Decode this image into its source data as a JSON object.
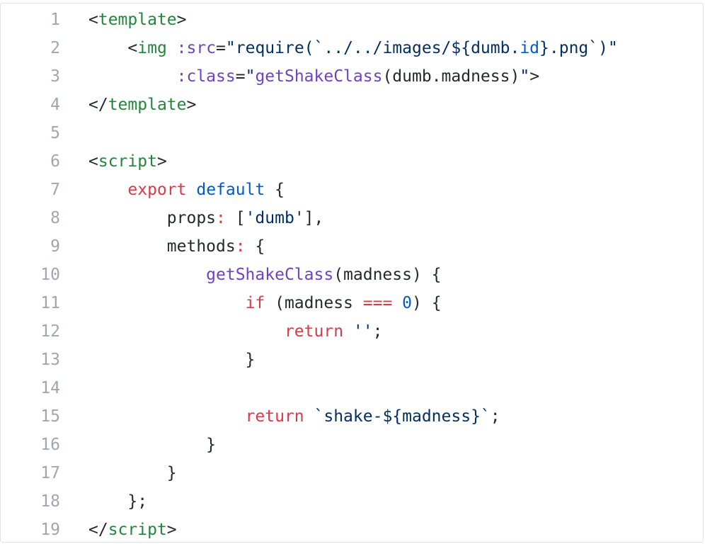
{
  "colors": {
    "tag": "#22863a",
    "attr": "#6f42c1",
    "string": "#032f62",
    "keyword": "#d73a49",
    "constant": "#005cc5",
    "function": "#6f42c1",
    "plain": "#24292e",
    "line_number": "#a0a6ad",
    "border": "#e1e4e8"
  },
  "lines": [
    {
      "n": "1",
      "tokens": [
        [
          "plain",
          "<"
        ],
        [
          "tag",
          "template"
        ],
        [
          "plain",
          ">"
        ]
      ]
    },
    {
      "n": "2",
      "tokens": [
        [
          "plain",
          "    <"
        ],
        [
          "tag",
          "img"
        ],
        [
          "plain",
          " "
        ],
        [
          "attr",
          ":src"
        ],
        [
          "plain",
          "="
        ],
        [
          "str",
          "\"require(`../../images/${dumb."
        ],
        [
          "const",
          "id"
        ],
        [
          "str",
          "}.png`)\""
        ]
      ]
    },
    {
      "n": "3",
      "tokens": [
        [
          "plain",
          "         "
        ],
        [
          "attr",
          ":class"
        ],
        [
          "plain",
          "="
        ],
        [
          "str",
          "\""
        ],
        [
          "fn",
          "getShakeClass"
        ],
        [
          "plain",
          "(dumb.madness)"
        ],
        [
          "str",
          "\""
        ],
        [
          "plain",
          ">"
        ]
      ]
    },
    {
      "n": "4",
      "tokens": [
        [
          "plain",
          "</"
        ],
        [
          "tag",
          "template"
        ],
        [
          "plain",
          ">"
        ]
      ]
    },
    {
      "n": "5",
      "tokens": []
    },
    {
      "n": "6",
      "tokens": [
        [
          "plain",
          "<"
        ],
        [
          "tag",
          "script"
        ],
        [
          "plain",
          ">"
        ]
      ]
    },
    {
      "n": "7",
      "tokens": [
        [
          "plain",
          "    "
        ],
        [
          "kw",
          "export"
        ],
        [
          "plain",
          " "
        ],
        [
          "const",
          "default"
        ],
        [
          "plain",
          " {"
        ]
      ]
    },
    {
      "n": "8",
      "tokens": [
        [
          "plain",
          "        props"
        ],
        [
          "kw",
          ":"
        ],
        [
          "plain",
          " ["
        ],
        [
          "str",
          "'dumb'"
        ],
        [
          "plain",
          "],"
        ]
      ]
    },
    {
      "n": "9",
      "tokens": [
        [
          "plain",
          "        methods"
        ],
        [
          "kw",
          ":"
        ],
        [
          "plain",
          " {"
        ]
      ]
    },
    {
      "n": "10",
      "tokens": [
        [
          "plain",
          "            "
        ],
        [
          "fn",
          "getShakeClass"
        ],
        [
          "plain",
          "(madness) {"
        ]
      ]
    },
    {
      "n": "11",
      "tokens": [
        [
          "plain",
          "                "
        ],
        [
          "kw",
          "if"
        ],
        [
          "plain",
          " (madness "
        ],
        [
          "kw",
          "==="
        ],
        [
          "plain",
          " "
        ],
        [
          "const",
          "0"
        ],
        [
          "plain",
          ") {"
        ]
      ]
    },
    {
      "n": "12",
      "tokens": [
        [
          "plain",
          "                    "
        ],
        [
          "kw",
          "return"
        ],
        [
          "plain",
          " "
        ],
        [
          "str",
          "''"
        ],
        [
          "plain",
          ";"
        ]
      ]
    },
    {
      "n": "13",
      "tokens": [
        [
          "plain",
          "                }"
        ]
      ]
    },
    {
      "n": "14",
      "tokens": []
    },
    {
      "n": "15",
      "tokens": [
        [
          "plain",
          "                "
        ],
        [
          "kw",
          "return"
        ],
        [
          "plain",
          " "
        ],
        [
          "str",
          "`shake-${madness}`"
        ],
        [
          "plain",
          ";"
        ]
      ]
    },
    {
      "n": "16",
      "tokens": [
        [
          "plain",
          "            }"
        ]
      ]
    },
    {
      "n": "17",
      "tokens": [
        [
          "plain",
          "        }"
        ]
      ]
    },
    {
      "n": "18",
      "tokens": [
        [
          "plain",
          "    };"
        ]
      ]
    },
    {
      "n": "19",
      "tokens": [
        [
          "plain",
          "</"
        ],
        [
          "tag",
          "script"
        ],
        [
          "plain",
          ">"
        ]
      ]
    }
  ]
}
